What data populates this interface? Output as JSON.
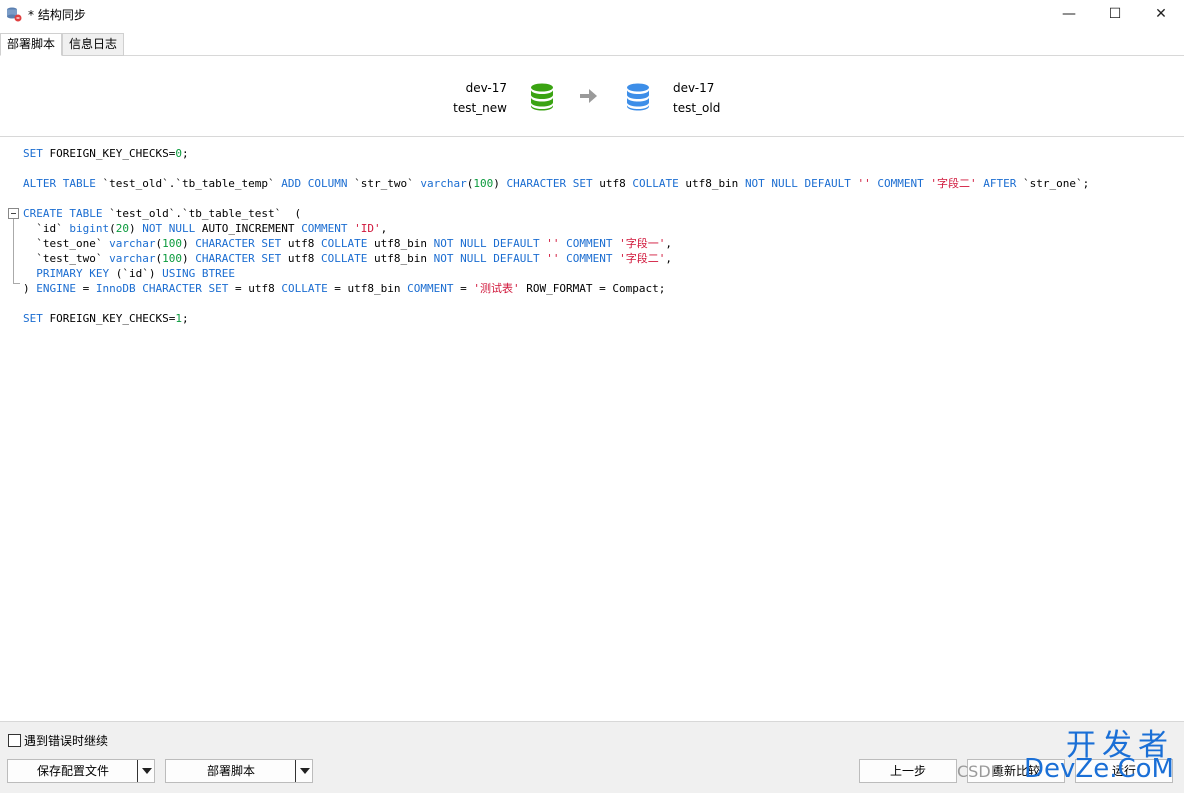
{
  "window": {
    "title": "* 结构同步",
    "minimize_glyph": "—",
    "maximize_glyph": "☐",
    "close_glyph": "✕"
  },
  "tabs": [
    {
      "label": "部署脚本"
    },
    {
      "label": "信息日志"
    }
  ],
  "source": {
    "server": "dev-17",
    "database": "test_new",
    "icon": "database-icon",
    "color": "#3aa312"
  },
  "target": {
    "server": "dev-17",
    "database": "test_old",
    "icon": "database-icon",
    "color": "#3d8ee8"
  },
  "arrow_icon": "arrow-right-icon",
  "script": {
    "line1": {
      "kw1": "SET",
      "t1": " FOREIGN_KEY_CHECKS=",
      "n1": "0",
      "t2": ";"
    },
    "line2": {
      "kw1": "ALTER TABLE",
      "t1": " `test_old`.`tb_table_temp` ",
      "kw2": "ADD COLUMN",
      "t2": " `str_two` ",
      "kw3": "varchar",
      "t3": "(",
      "n1": "100",
      "t4": ") ",
      "kw4": "CHARACTER SET",
      "t5": " utf8 ",
      "kw5": "COLLATE",
      "t6": " utf8_bin ",
      "kw6": "NOT NULL DEFAULT",
      "t7": " ",
      "s1": "''",
      "t8": " ",
      "kw7": "COMMENT",
      "t9": " ",
      "s2": "'字段二'",
      "t10": " ",
      "kw8": "AFTER",
      "t11": " `str_one`;"
    },
    "line3": {
      "kw1": "CREATE TABLE",
      "t1": " `test_old`.`tb_table_test`  ("
    },
    "line4": {
      "t1": "  `id` ",
      "kw1": "bigint",
      "t2": "(",
      "n1": "20",
      "t3": ") ",
      "kw2": "NOT NULL",
      "t4": " AUTO_INCREMENT ",
      "kw3": "COMMENT",
      "t5": " ",
      "s1": "'ID'",
      "t6": ","
    },
    "line5": {
      "t1": "  `test_one` ",
      "kw1": "varchar",
      "t2": "(",
      "n1": "100",
      "t3": ") ",
      "kw2": "CHARACTER SET",
      "t4": " utf8 ",
      "kw3": "COLLATE",
      "t5": " utf8_bin ",
      "kw4": "NOT NULL DEFAULT",
      "t6": " ",
      "s1": "''",
      "t7": " ",
      "kw5": "COMMENT",
      "t8": " ",
      "s2": "'字段一'",
      "t9": ","
    },
    "line6": {
      "t1": "  `test_two` ",
      "kw1": "varchar",
      "t2": "(",
      "n1": "100",
      "t3": ") ",
      "kw2": "CHARACTER SET",
      "t4": " utf8 ",
      "kw3": "COLLATE",
      "t5": " utf8_bin ",
      "kw4": "NOT NULL DEFAULT",
      "t6": " ",
      "s1": "''",
      "t7": " ",
      "kw5": "COMMENT",
      "t8": " ",
      "s2": "'字段二'",
      "t9": ","
    },
    "line7": {
      "t1": "  ",
      "kw1": "PRIMARY KEY",
      "t2": " (`id`) ",
      "kw2": "USING BTREE"
    },
    "line8": {
      "t1": ") ",
      "kw1": "ENGINE",
      "t2": " = ",
      "kw2": "InnoDB",
      "t3": " ",
      "kw3": "CHARACTER SET",
      "t4": " = utf8 ",
      "kw4": "COLLATE",
      "t5": " = utf8_bin ",
      "kw5": "COMMENT",
      "t6": " = ",
      "s1": "'测试表'",
      "t7": " ROW_FORMAT = Compact;"
    },
    "line9": {
      "kw1": "SET",
      "t1": " FOREIGN_KEY_CHECKS=",
      "n1": "1",
      "t2": ";"
    }
  },
  "bottom": {
    "continue_on_error_label": "遇到错误时继续",
    "save_config_label": "保存配置文件",
    "deploy_script_label": "部署脚本",
    "prev_label": "上一步",
    "recompare_label": "重新比较",
    "run_label": "运行"
  },
  "watermark": {
    "line1": "开发者",
    "line2": "DevZe.CoM",
    "overlay": "CSDN"
  }
}
